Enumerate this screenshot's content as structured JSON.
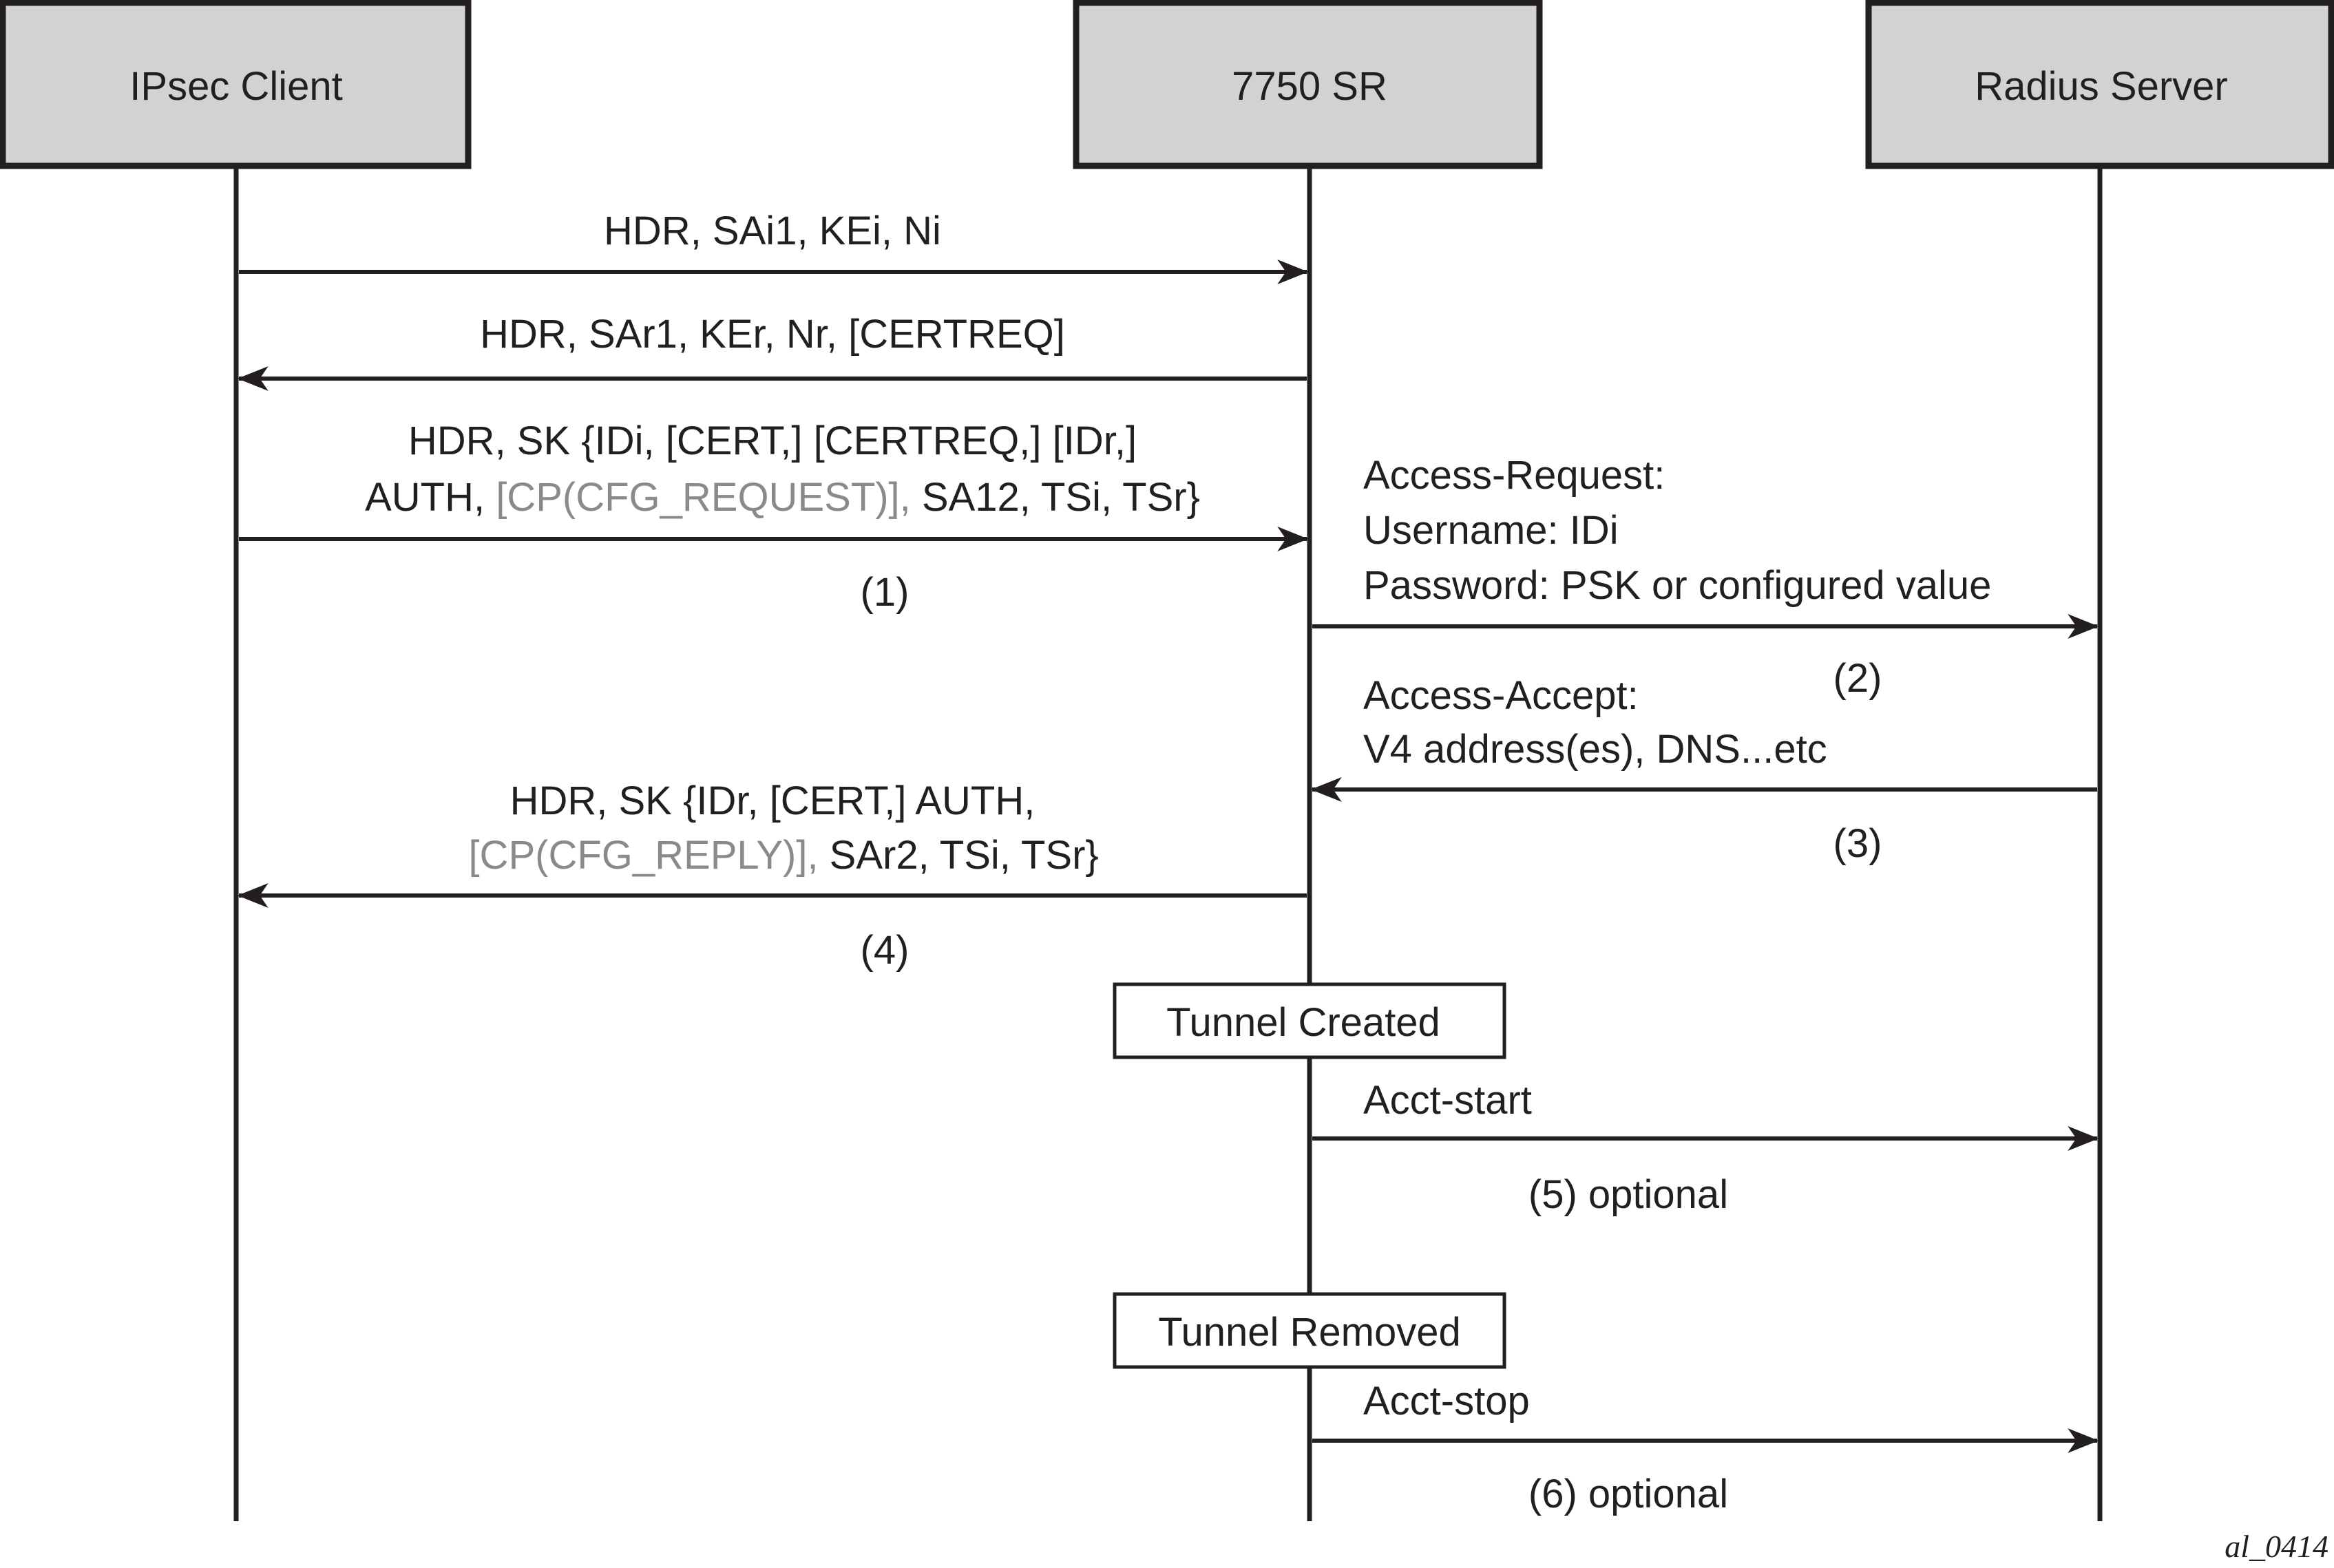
{
  "participants": [
    {
      "id": "client",
      "label": "IPsec Client"
    },
    {
      "id": "sr",
      "label": "7750 SR"
    },
    {
      "id": "radius",
      "label": "Radius Server"
    }
  ],
  "messages": [
    {
      "step": "(1)",
      "from": "client",
      "to": "sr",
      "lines": [
        [
          {
            "t": "HDR, SAi1, KEi, Ni",
            "grey": false
          }
        ]
      ]
    },
    {
      "from": "sr",
      "to": "client",
      "lines": [
        [
          {
            "t": "HDR, SAr1, KEr, Nr, [CERTREQ]",
            "grey": false
          }
        ]
      ]
    },
    {
      "from": "client",
      "to": "sr",
      "lines": [
        [
          {
            "t": "HDR, SK {IDi, [CERT,] [CERTREQ,] [IDr,]",
            "grey": false
          }
        ],
        [
          {
            "t": "AUTH, ",
            "grey": false
          },
          {
            "t": "[CP(CFG_REQUEST)],",
            "grey": true
          },
          {
            "t": " SA12, TSi, TSr}",
            "grey": false
          }
        ]
      ]
    },
    {
      "from": "sr",
      "to": "radius",
      "lines": [
        [
          {
            "t": "Access-Request:",
            "grey": false
          }
        ],
        [
          {
            "t": "Username: IDi",
            "grey": false
          }
        ],
        [
          {
            "t": "Password: PSK or configured value",
            "grey": false
          }
        ]
      ]
    },
    {
      "from": "radius",
      "to": "sr",
      "lines": [
        [
          {
            "t": "Access-Accept:",
            "grey": false
          }
        ],
        [
          {
            "t": "V4 address(es), DNS...etc",
            "grey": false
          }
        ]
      ]
    },
    {
      "from": "sr",
      "to": "client",
      "lines": [
        [
          {
            "t": "HDR, SK {IDr, [CERT,] AUTH,",
            "grey": false
          }
        ],
        [
          {
            "t": "[CP(CFG_REPLY)],",
            "grey": true
          },
          {
            "t": " SAr2, TSi, TSr}",
            "grey": false
          }
        ]
      ]
    },
    {
      "from": "sr",
      "to": "radius",
      "lines": [
        [
          {
            "t": "Acct-start",
            "grey": false
          }
        ]
      ]
    },
    {
      "from": "sr",
      "to": "radius",
      "lines": [
        [
          {
            "t": "Acct-stop",
            "grey": false
          }
        ]
      ]
    }
  ],
  "step_labels": [
    "(1)",
    "(2)",
    "(3)",
    "(4)",
    "(5) optional",
    "(6) optional"
  ],
  "events": [
    "Tunnel Created",
    "Tunnel Removed"
  ],
  "figure_id": "al_0414",
  "colors": {
    "ink": "#231f20",
    "box_fill": "#d1d2d4",
    "grey_text": "#8a8a8c"
  }
}
